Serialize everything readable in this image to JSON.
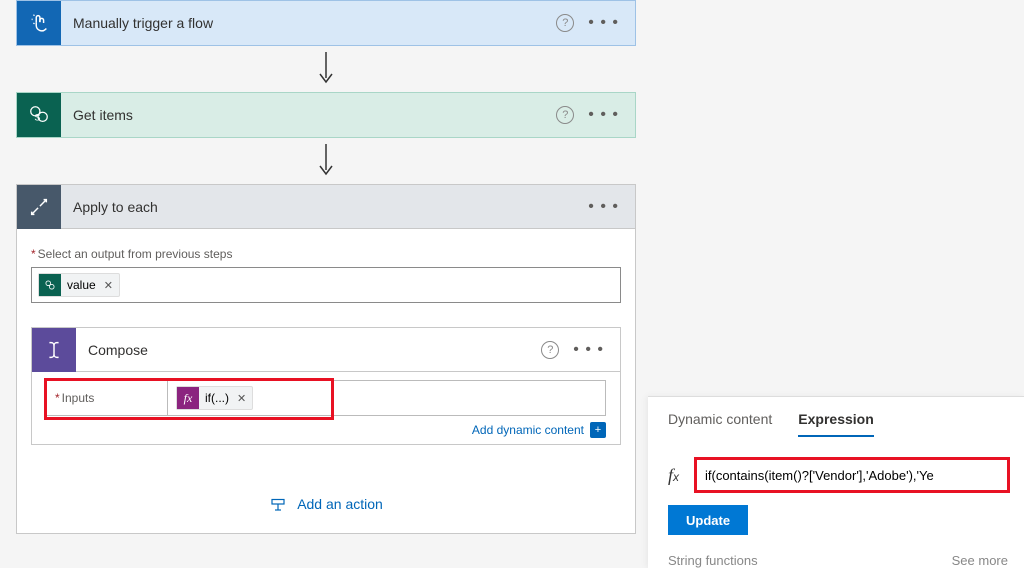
{
  "trigger": {
    "title": "Manually trigger a flow"
  },
  "getItems": {
    "title": "Get items"
  },
  "applyEach": {
    "title": "Apply to each",
    "selectLabel": "Select an output from previous steps",
    "valueChip": "value"
  },
  "compose": {
    "title": "Compose",
    "inputsLabel": "Inputs",
    "fxChip": "if(...)"
  },
  "dynLink": "Add dynamic content",
  "addAction": "Add an action",
  "exprPanel": {
    "tabDynamic": "Dynamic content",
    "tabExpression": "Expression",
    "expression": "if(contains(item()?['Vendor'],'Adobe'),'Ye",
    "updateBtn": "Update",
    "sectionLabel": "String functions",
    "seeMore": "See more"
  }
}
